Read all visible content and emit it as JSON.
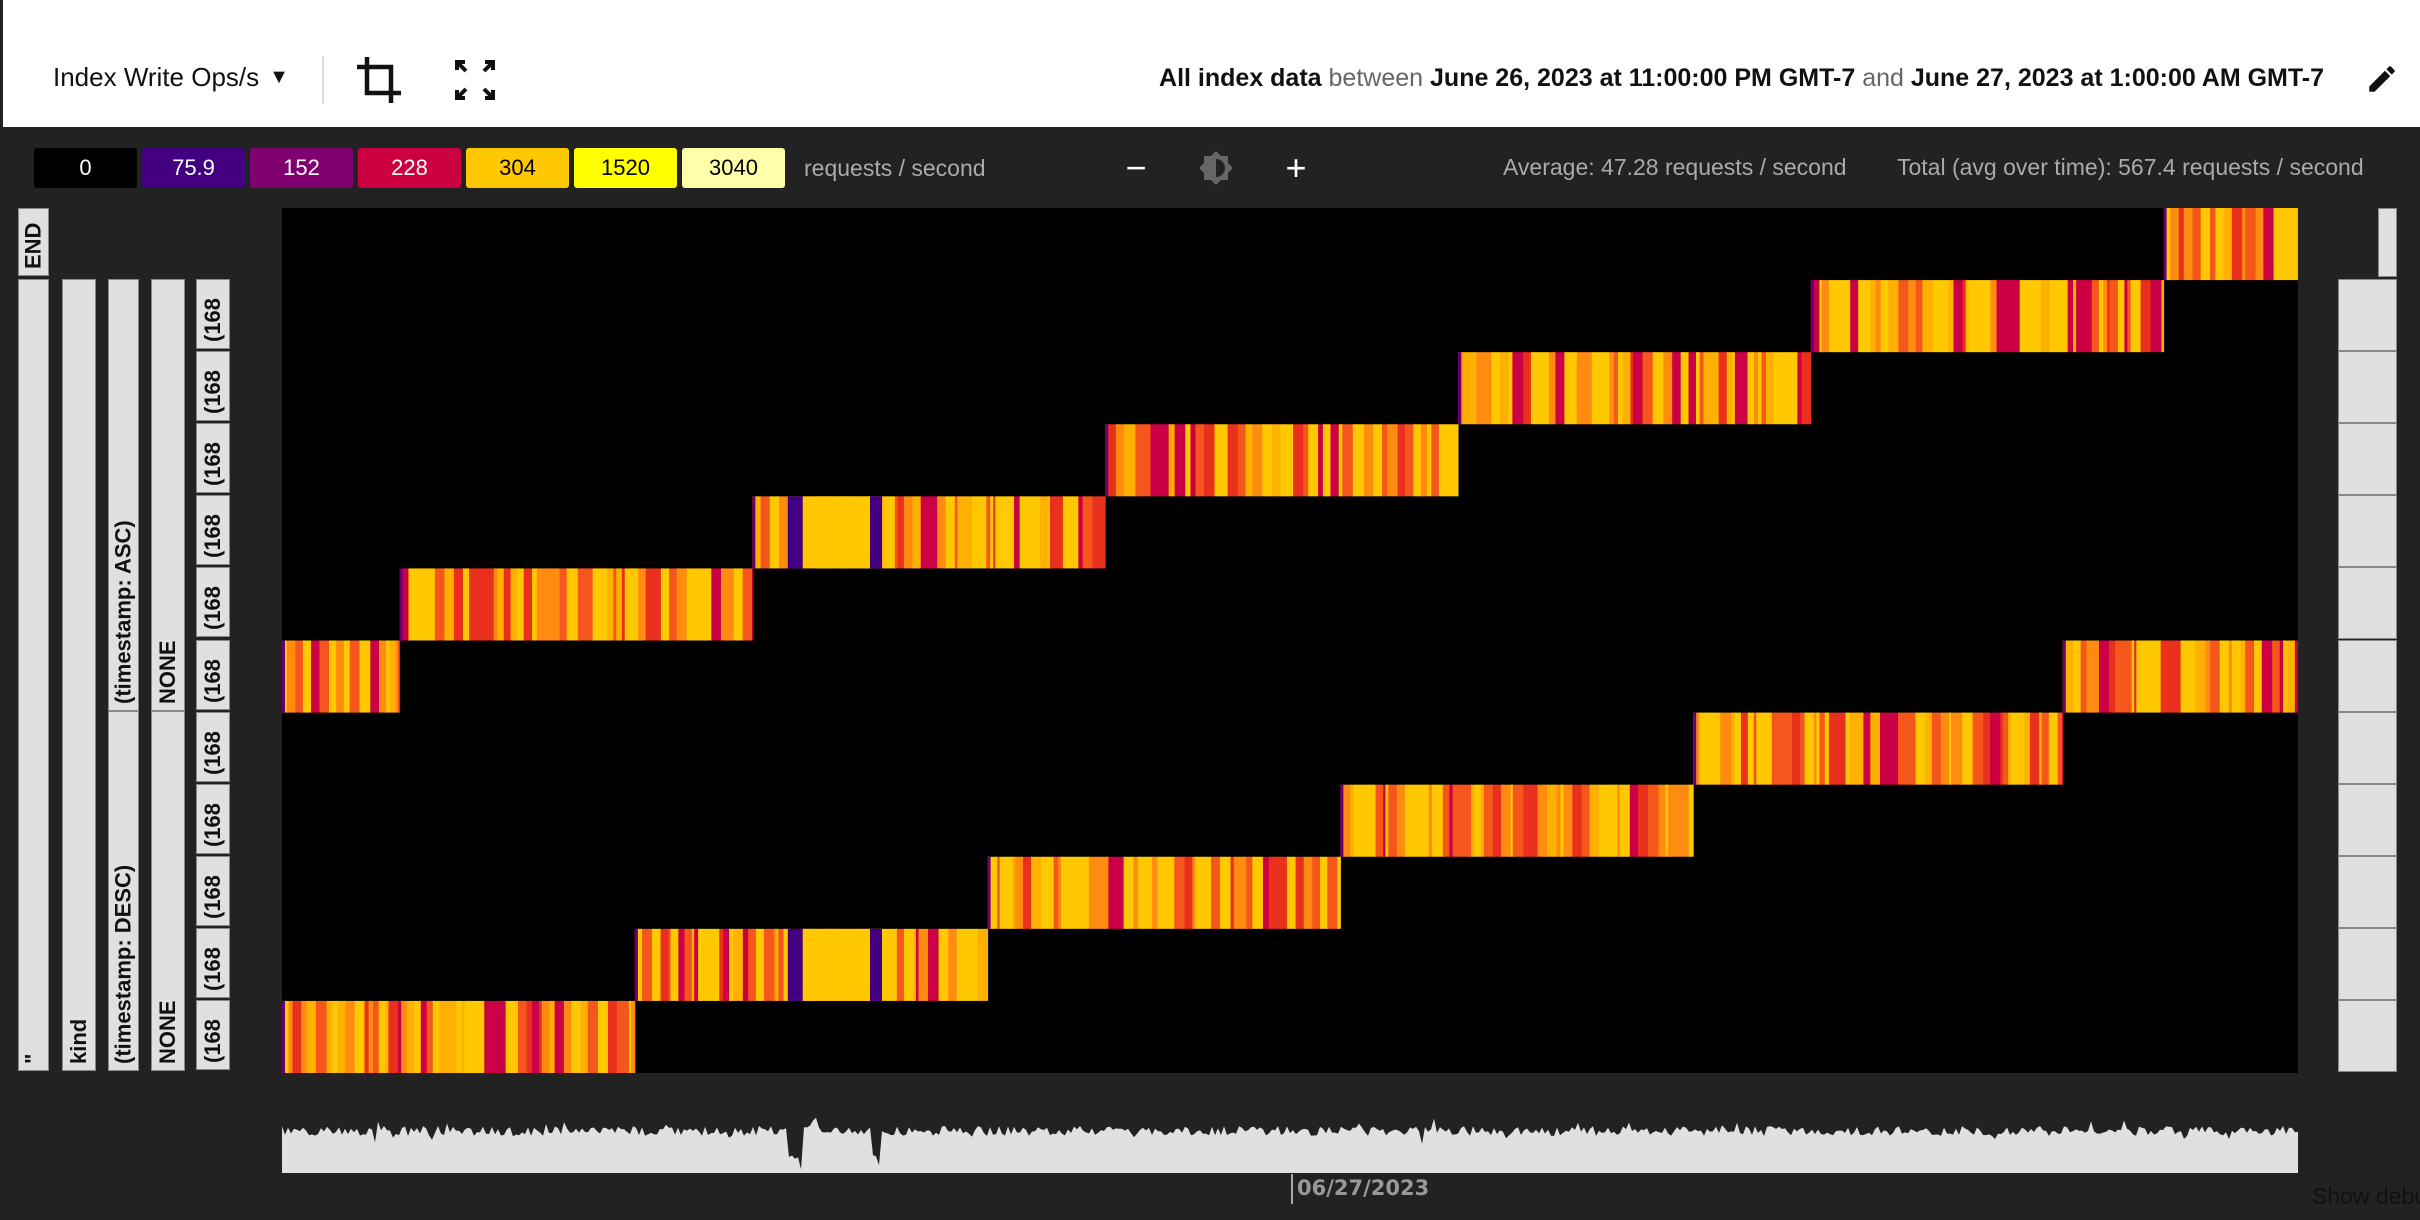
{
  "header": {
    "metric": "Index Write Ops/s",
    "range_prefix": "All index data",
    "between": "between",
    "start": "June 26, 2023 at 11:00:00 PM GMT-7",
    "and": "and",
    "end": "June 27, 2023 at 1:00:00 AM GMT-7",
    "icons": [
      "crop-icon",
      "fullscreen-icon",
      "pencil-icon",
      "caret-down-icon"
    ]
  },
  "legend": {
    "stops": [
      {
        "label": "0",
        "color": "#000000",
        "text": "#ffffff"
      },
      {
        "label": "75.9",
        "color": "#420080",
        "text": "#ffffff"
      },
      {
        "label": "152",
        "color": "#800070",
        "text": "#ffffff"
      },
      {
        "label": "228",
        "color": "#cc0040",
        "text": "#ffffff"
      },
      {
        "label": "304",
        "color": "#ffc800",
        "text": "#000000"
      },
      {
        "label": "1520",
        "color": "#ffff00",
        "text": "#000000"
      },
      {
        "label": "3040",
        "color": "#ffffaa",
        "text": "#000000"
      }
    ],
    "unit": "requests / second"
  },
  "zoom_controls": {
    "minus": "−",
    "plus": "+",
    "brightness_icon": "brightness-icon"
  },
  "stats": {
    "average": "Average: 47.28 requests / second",
    "total": "Total (avg over time): 567.4 requests / second"
  },
  "key_labels": {
    "end": "END",
    "col1": "\"",
    "col2": "kind",
    "col3": [
      "(timestamp: ASC)",
      "(timestamp: DESC)"
    ],
    "col4": [
      "NONE",
      "NONE"
    ],
    "col5": [
      "(168",
      "(168",
      "(168",
      "(168",
      "(168",
      "(168",
      "(168",
      "(168",
      "(168",
      "(168",
      "(168"
    ]
  },
  "chart_data": {
    "type": "heatmap",
    "x_range": [
      "2023-06-26 23:00",
      "2023-06-27 01:00"
    ],
    "rows": 12,
    "active_segments": [
      {
        "row": 0,
        "start": "00:52",
        "end": "01:00"
      },
      {
        "row": 1,
        "start": "00:31",
        "end": "00:52"
      },
      {
        "row": 2,
        "start": "00:10",
        "end": "00:31"
      },
      {
        "row": 3,
        "start": "23:49",
        "end": "00:10"
      },
      {
        "row": 4,
        "start": "23:28",
        "end": "23:49"
      },
      {
        "row": 5,
        "start": "23:07",
        "end": "23:28"
      },
      {
        "row": 6,
        "start": "23:00",
        "end": "23:07"
      },
      {
        "row": 6,
        "start": "00:46",
        "end": "01:00"
      },
      {
        "row": 7,
        "start": "00:24",
        "end": "00:46"
      },
      {
        "row": 8,
        "start": "00:03",
        "end": "00:24"
      },
      {
        "row": 9,
        "start": "23:42",
        "end": "00:03"
      },
      {
        "row": 10,
        "start": "23:21",
        "end": "23:42"
      },
      {
        "row": 11,
        "start": "23:00",
        "end": "23:21"
      }
    ],
    "steady_segments": [
      {
        "rows": [
          4,
          10
        ],
        "start": "23:31",
        "end": "23:35",
        "value": 304
      }
    ],
    "x_tick": "06/27/2023"
  },
  "footer": {
    "debug": "Show debug"
  }
}
